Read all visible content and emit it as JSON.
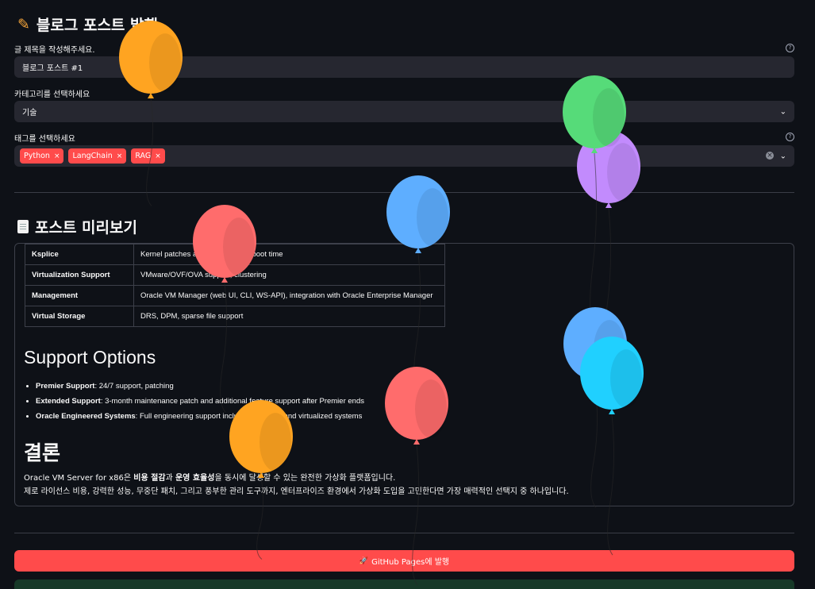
{
  "header": {
    "title": "블로그 포스트 발행"
  },
  "form": {
    "title_label": "글 제목을 작성해주세요.",
    "title_value": "블로그 포스트 #1",
    "category_label": "카테고리를 선택하세요",
    "category_value": "기술",
    "tags_label": "태그를 선택하세요",
    "tags": [
      "Python",
      "LangChain",
      "RAG"
    ],
    "help_glyph": "?",
    "remove_glyph": "×",
    "chevron_glyph": "⌄",
    "clear_glyph": "×"
  },
  "preview": {
    "title": "포스트 미리보기",
    "table": [
      {
        "key": "Ksplice",
        "value": "Kernel patches applied without reboot time"
      },
      {
        "key": "Virtualization Support",
        "value": "VMware/OVF/OVA support, clustering"
      },
      {
        "key": "Management",
        "value": "Oracle VM Manager (web UI, CLI, WS-API), integration with Oracle Enterprise Manager"
      },
      {
        "key": "Virtual Storage",
        "value": "DRS, DPM, sparse file support"
      }
    ],
    "support_title": "Support Options",
    "support_items": [
      {
        "name": "Premier Support",
        "desc": ": 24/7 support, patching"
      },
      {
        "name": "Extended Support",
        "desc": ": 3-month maintenance patch and additional feature support after Premier ends"
      },
      {
        "name": "Oracle Engineered Systems",
        "desc": ": Full engineering support including physical and virtualized systems"
      }
    ],
    "conclusion_title": "결론",
    "conclusion": {
      "p1_a": "Oracle VM Server for x86은 ",
      "p1_b": "비용 절감",
      "p1_c": "과 ",
      "p1_d": "운영 효율성",
      "p1_e": "을 동시에 달성할 수 있는 완전한 가상화 플랫폼입니다.",
      "p2": "제로 라이선스 비용, 강력한 성능, 무중단 패치, 그리고 풍부한 관리 도구까지, 엔터프라이즈 환경에서 가상화 도입을 고민한다면 가장 매력적인 선택지 중 하나입니다."
    }
  },
  "actions": {
    "publish_icon": "🚀",
    "publish_label": "GitHub Pages에 발행"
  },
  "balloons": {
    "colors": {
      "orange": "#ffa421",
      "green": "#56db79",
      "purple": "#c28bfd",
      "blue": "#5eaeff",
      "red": "#ff6c6c",
      "cyan": "#20d0ff"
    }
  }
}
